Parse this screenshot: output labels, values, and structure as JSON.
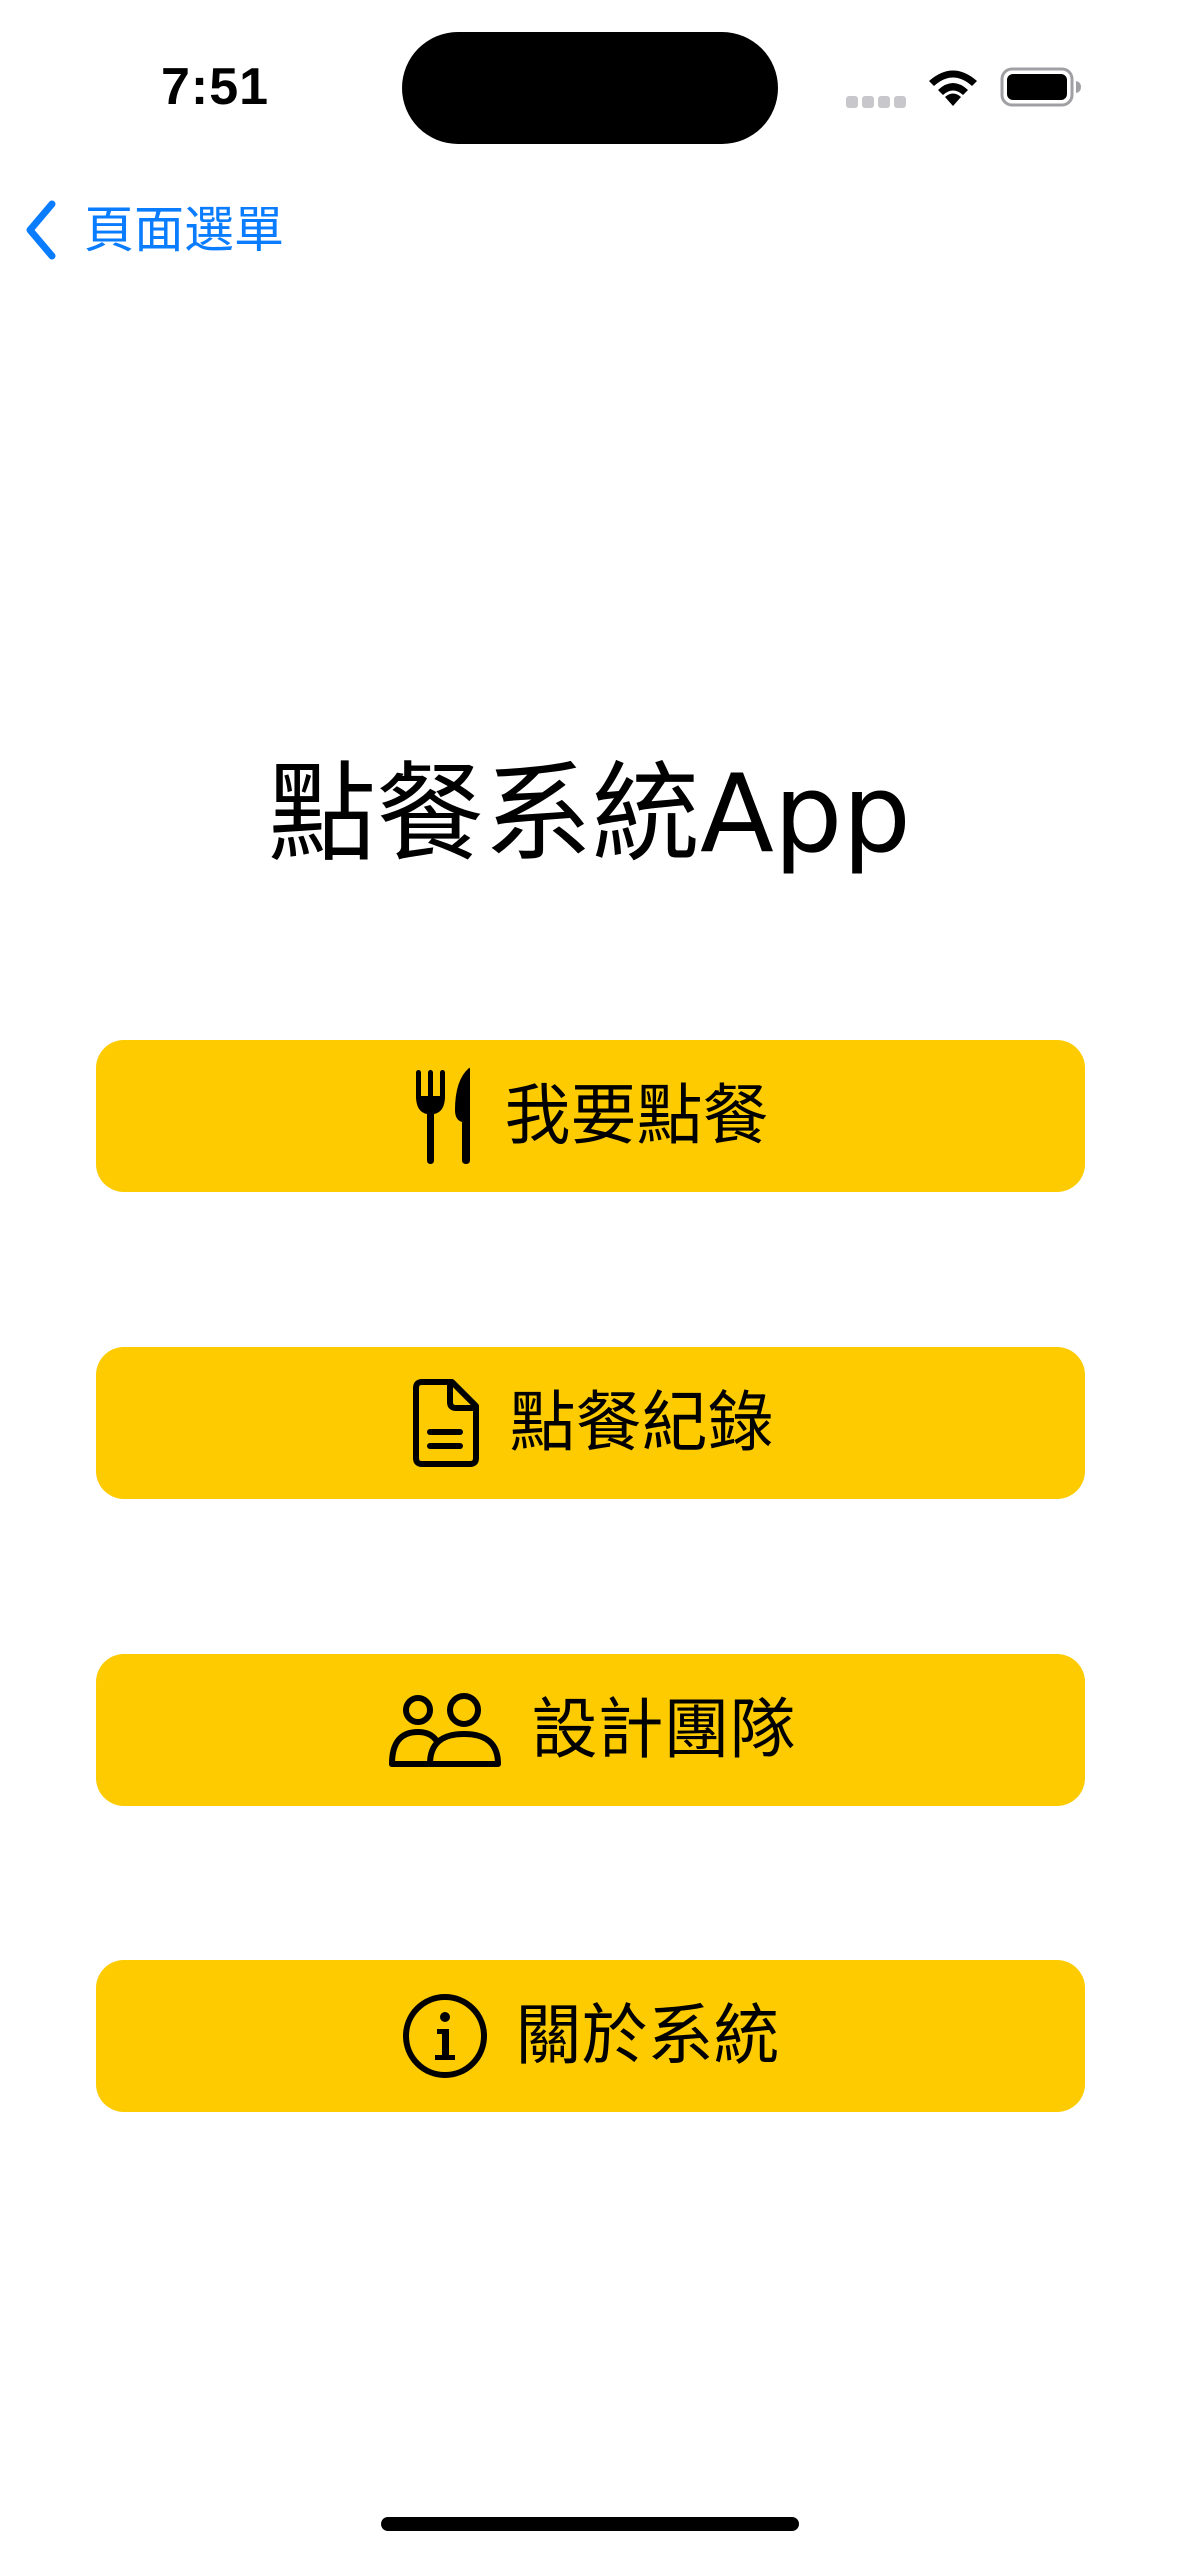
{
  "status_bar": {
    "time": "7:51",
    "icons": [
      "cellular-signal-icon",
      "wifi-icon",
      "battery-icon"
    ]
  },
  "nav": {
    "back_label": "頁面選單",
    "back_icon": "chevron-left-icon"
  },
  "title": "點餐系統App",
  "menu": {
    "items": [
      {
        "label": "我要點餐",
        "icon": "fork-knife-icon"
      },
      {
        "label": "點餐紀錄",
        "icon": "document-icon"
      },
      {
        "label": "設計團隊",
        "icon": "people-icon"
      },
      {
        "label": "關於系統",
        "icon": "info-circle-icon"
      }
    ]
  },
  "colors": {
    "accent": "#0a7cff",
    "button_background": "#fdcb00",
    "text": "#000000",
    "background": "#ffffff"
  }
}
